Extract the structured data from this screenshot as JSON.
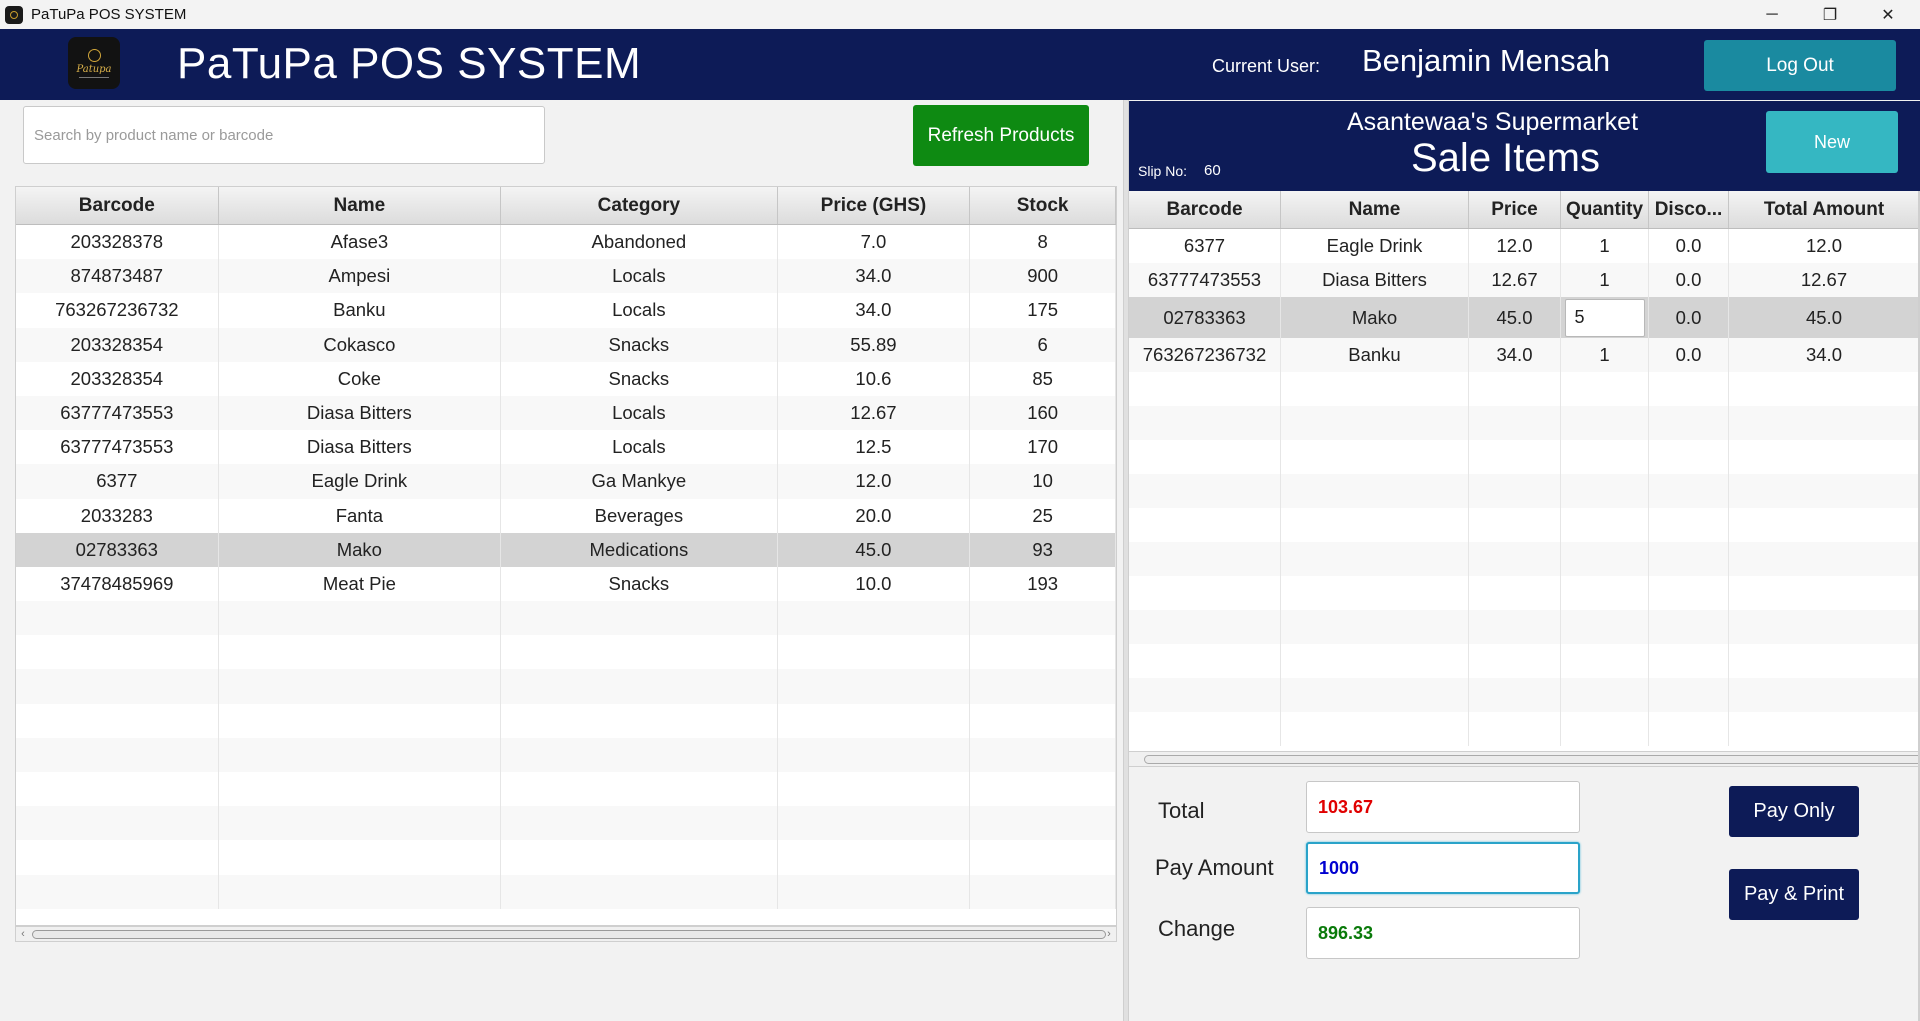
{
  "window": {
    "title": "PaTuPa POS SYSTEM",
    "minimize": "─",
    "restore": "❐",
    "close": "✕"
  },
  "header": {
    "logo_text": "Patupa",
    "app_title": "PaTuPa POS SYSTEM",
    "current_user_label": "Current User:",
    "current_user": "Benjamin Mensah",
    "logout_label": "Log Out"
  },
  "products": {
    "search_placeholder": "Search by product name or barcode",
    "refresh_label": "Refresh Products",
    "columns": [
      "Barcode",
      "Name",
      "Category",
      "Price (GHS)",
      "Stock"
    ],
    "rows": [
      [
        "203328378",
        "Afase3",
        "Abandoned",
        "7.0",
        "8"
      ],
      [
        "874873487",
        "Ampesi",
        "Locals",
        "34.0",
        "900"
      ],
      [
        "763267236732",
        "Banku",
        "Locals",
        "34.0",
        "175"
      ],
      [
        "203328354",
        "Cokasco",
        "Snacks",
        "55.89",
        "6"
      ],
      [
        "203328354",
        "Coke",
        "Snacks",
        "10.6",
        "85"
      ],
      [
        "63777473553",
        "Diasa Bitters",
        "Locals",
        "12.67",
        "160"
      ],
      [
        "63777473553",
        "Diasa Bitters",
        "Locals",
        "12.5",
        "170"
      ],
      [
        "6377",
        "Eagle Drink",
        "Ga Mankye",
        "12.0",
        "10"
      ],
      [
        "2033283",
        "Fanta",
        "Beverages",
        "20.0",
        "25"
      ],
      [
        "02783363",
        "Mako",
        "Medications",
        "45.0",
        "93"
      ],
      [
        "37478485969",
        "Meat Pie",
        "Snacks",
        "10.0",
        "193"
      ]
    ],
    "selected_row": 9
  },
  "sale": {
    "shop_name": "Asantewaa's Supermarket",
    "title": "Sale Items",
    "slip_label": "Slip No:",
    "slip_no": "60",
    "new_label": "New",
    "columns": [
      "Barcode",
      "Name",
      "Price",
      "Quantity",
      "Disco...",
      "Total Amount"
    ],
    "rows": [
      [
        "6377",
        "Eagle Drink",
        "12.0",
        "1",
        "0.0",
        "12.0"
      ],
      [
        "63777473553",
        "Diasa Bitters",
        "12.67",
        "1",
        "0.0",
        "12.67"
      ],
      [
        "02783363",
        "Mako",
        "45.0",
        "5",
        "0.0",
        "45.0"
      ],
      [
        "763267236732",
        "Banku",
        "34.0",
        "1",
        "0.0",
        "34.0"
      ]
    ],
    "editing_row": 2
  },
  "payment": {
    "total_label": "Total",
    "total_value": "103.67",
    "pay_label": "Pay Amount",
    "pay_value": "1000",
    "change_label": "Change",
    "change_value": "896.33",
    "pay_only_label": "Pay Only",
    "pay_print_label": "Pay & Print"
  },
  "colors": {
    "header_bg": "#0d1b57",
    "logout_bg": "#1a8aa0",
    "refresh_bg": "#0e8a12",
    "new_bg": "#35b7c2",
    "total_color": "#e00000",
    "pay_color": "#0000d0",
    "change_color": "#0a7a0a"
  }
}
